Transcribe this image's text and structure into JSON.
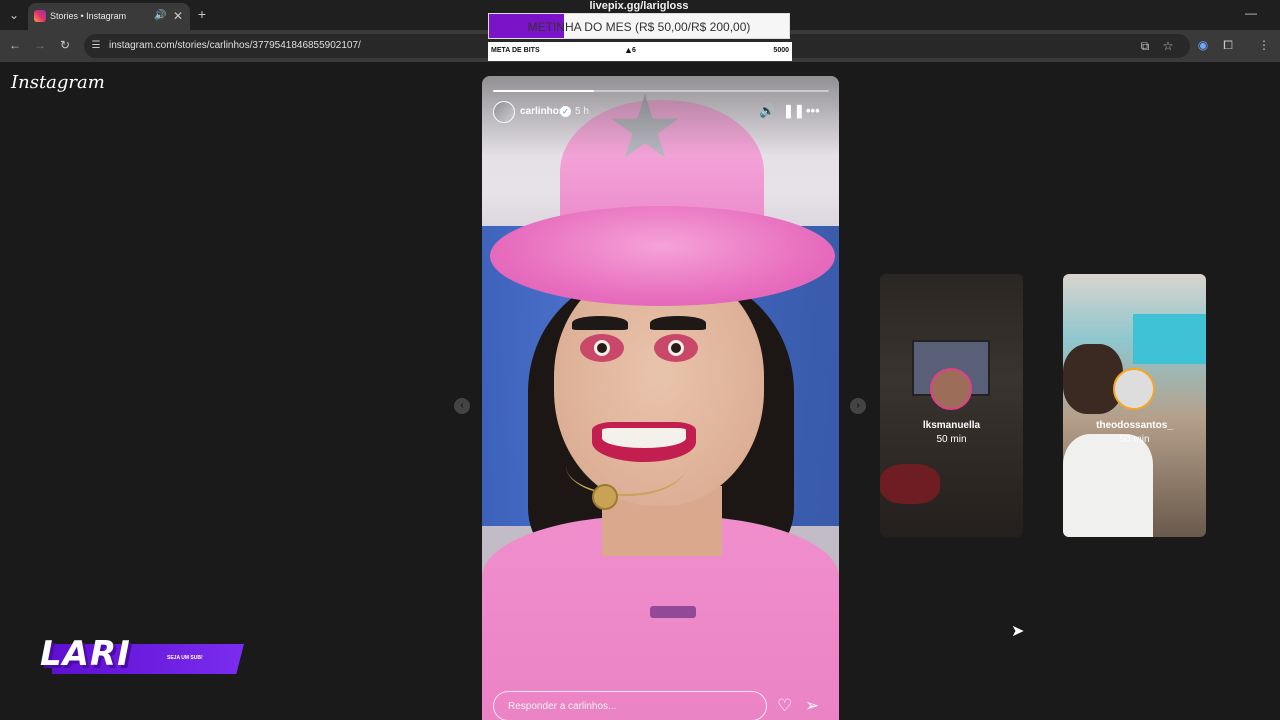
{
  "browser": {
    "tab_title": "Stories • Instagram",
    "url": "instagram.com/stories/carlinhos/3779541846855902107/",
    "icons": [
      "tab-list-icon",
      "instagram-favicon",
      "speaker-icon",
      "close-icon",
      "new-tab-icon",
      "back-icon",
      "forward-icon",
      "reload-icon",
      "site-info-icon",
      "cast-icon",
      "bookmark-star-icon",
      "extension-icon",
      "puzzle-icon",
      "menu-icon",
      "minimize-icon"
    ]
  },
  "instagram": {
    "logo": "Instagram"
  },
  "story": {
    "username": "carlinhos",
    "time": "5 h",
    "progress": 0.3,
    "reply_placeholder": "Responder a carlinhos...",
    "icons": [
      "volume-icon",
      "pause-icon",
      "more-options-icon",
      "heart-icon",
      "send-icon"
    ]
  },
  "previews": [
    {
      "username": "lksmanuella",
      "time": "50 min"
    },
    {
      "username": "theodossantos_",
      "time": "50 min"
    }
  ],
  "overlay": {
    "livepix_title": "livepix.gg/larigloss",
    "goal_text": "METINHA DO MES (R$ 50,00/R$ 200,00)",
    "goal_progress": 0.25,
    "bits_label": "META DE BITS",
    "bits_count": "6",
    "bits_goal": "5000",
    "lari_logo": "LARI",
    "lari_sub": "SEJA UM SUB!"
  },
  "colors": {
    "accent": "#7b13c9",
    "page_bg": "#1a1a1a"
  }
}
